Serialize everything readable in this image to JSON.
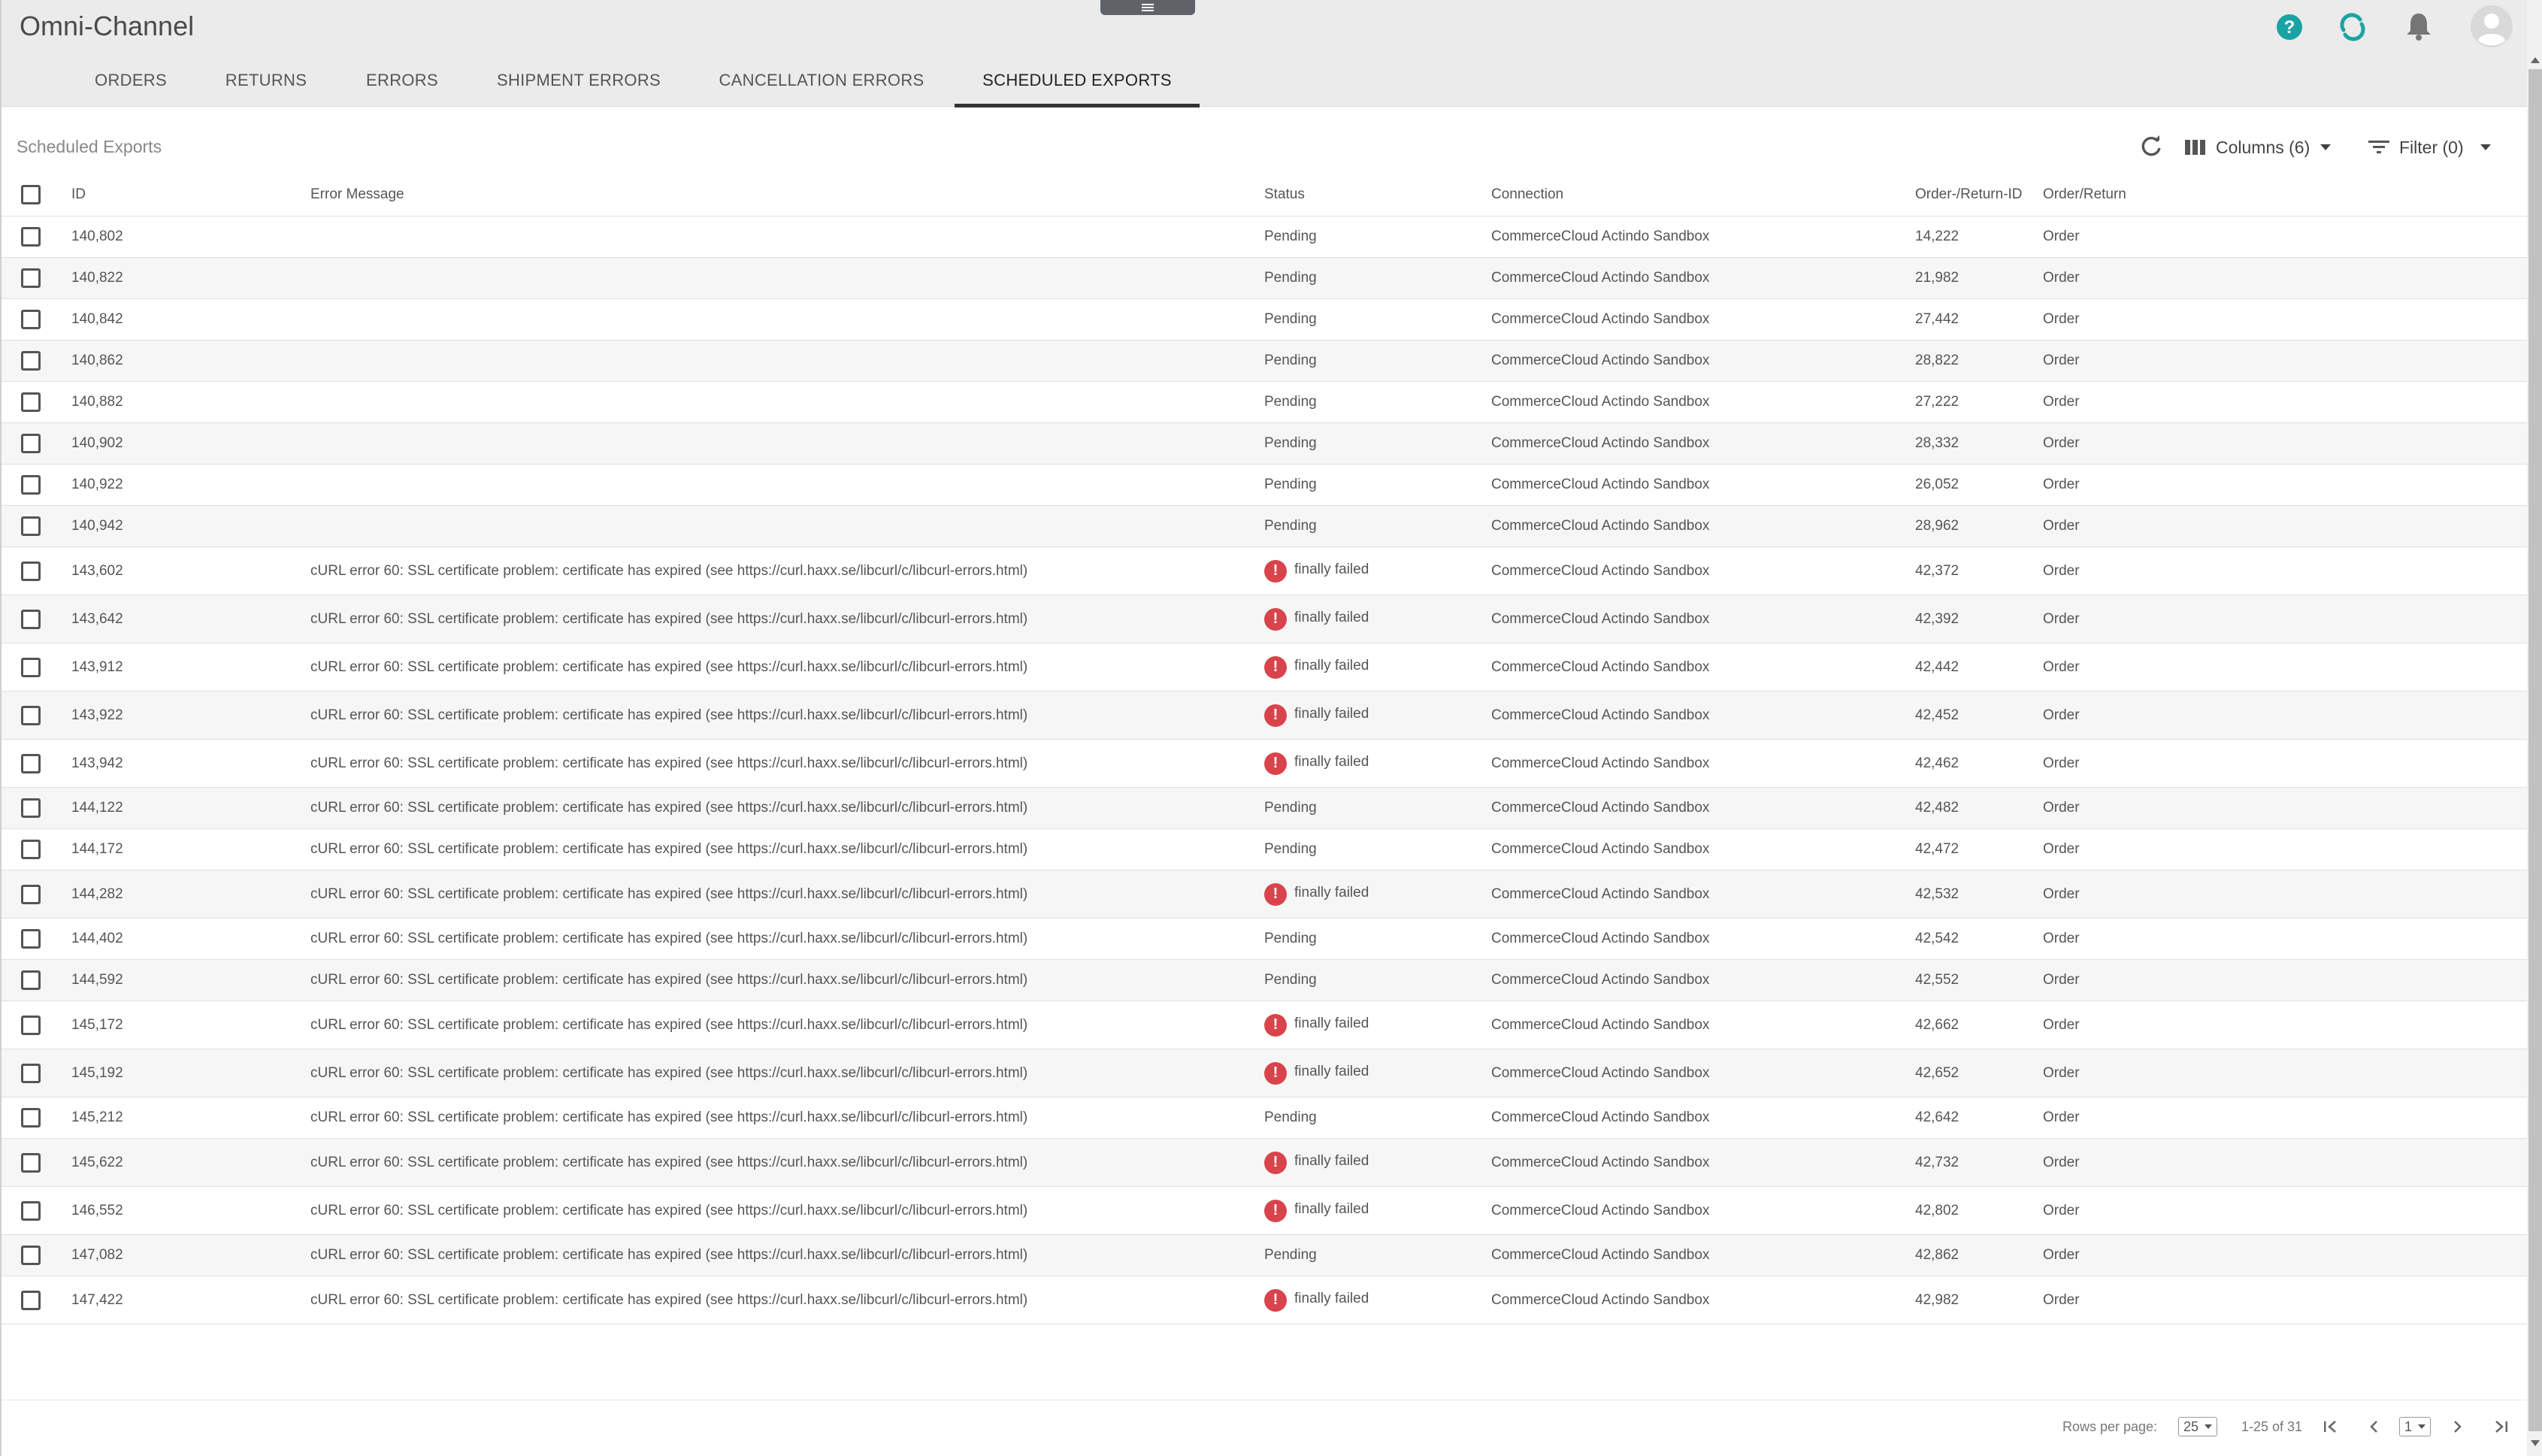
{
  "app": {
    "title": "Omni-Channel"
  },
  "tabs": [
    {
      "label": "ORDERS",
      "active": false
    },
    {
      "label": "RETURNS",
      "active": false
    },
    {
      "label": "ERRORS",
      "active": false
    },
    {
      "label": "SHIPMENT ERRORS",
      "active": false
    },
    {
      "label": "CANCELLATION ERRORS",
      "active": false
    },
    {
      "label": "SCHEDULED EXPORTS",
      "active": true
    }
  ],
  "header_icons": [
    "help-icon",
    "sync-icon",
    "bell-icon",
    "avatar-icon"
  ],
  "colors": {
    "accent": "#1aa3a3",
    "error": "#d9434b",
    "active_tab_underline": "#333333"
  },
  "toolbar": {
    "section_title": "Scheduled Exports",
    "refresh_icon": "refresh-icon",
    "columns_label": "Columns (6)",
    "filter_label": "Filter (0)"
  },
  "table": {
    "headers": {
      "id": "ID",
      "message": "Error Message",
      "status": "Status",
      "connection": "Connection",
      "order_id": "Order-/Return-ID",
      "type": "Order/Return"
    },
    "rows": [
      {
        "id": "140,802",
        "message": "",
        "status": "Pending",
        "failed": false,
        "connection": "CommerceCloud Actindo Sandbox",
        "order_id": "14,222",
        "type": "Order"
      },
      {
        "id": "140,822",
        "message": "",
        "status": "Pending",
        "failed": false,
        "connection": "CommerceCloud Actindo Sandbox",
        "order_id": "21,982",
        "type": "Order"
      },
      {
        "id": "140,842",
        "message": "",
        "status": "Pending",
        "failed": false,
        "connection": "CommerceCloud Actindo Sandbox",
        "order_id": "27,442",
        "type": "Order"
      },
      {
        "id": "140,862",
        "message": "",
        "status": "Pending",
        "failed": false,
        "connection": "CommerceCloud Actindo Sandbox",
        "order_id": "28,822",
        "type": "Order"
      },
      {
        "id": "140,882",
        "message": "",
        "status": "Pending",
        "failed": false,
        "connection": "CommerceCloud Actindo Sandbox",
        "order_id": "27,222",
        "type": "Order"
      },
      {
        "id": "140,902",
        "message": "",
        "status": "Pending",
        "failed": false,
        "connection": "CommerceCloud Actindo Sandbox",
        "order_id": "28,332",
        "type": "Order"
      },
      {
        "id": "140,922",
        "message": "",
        "status": "Pending",
        "failed": false,
        "connection": "CommerceCloud Actindo Sandbox",
        "order_id": "26,052",
        "type": "Order"
      },
      {
        "id": "140,942",
        "message": "",
        "status": "Pending",
        "failed": false,
        "connection": "CommerceCloud Actindo Sandbox",
        "order_id": "28,962",
        "type": "Order"
      },
      {
        "id": "143,602",
        "message": "cURL error 60: SSL certificate problem: certificate has expired (see https://curl.haxx.se/libcurl/c/libcurl-errors.html)",
        "status": "finally failed",
        "failed": true,
        "connection": "CommerceCloud Actindo Sandbox",
        "order_id": "42,372",
        "type": "Order"
      },
      {
        "id": "143,642",
        "message": "cURL error 60: SSL certificate problem: certificate has expired (see https://curl.haxx.se/libcurl/c/libcurl-errors.html)",
        "status": "finally failed",
        "failed": true,
        "connection": "CommerceCloud Actindo Sandbox",
        "order_id": "42,392",
        "type": "Order"
      },
      {
        "id": "143,912",
        "message": "cURL error 60: SSL certificate problem: certificate has expired (see https://curl.haxx.se/libcurl/c/libcurl-errors.html)",
        "status": "finally failed",
        "failed": true,
        "connection": "CommerceCloud Actindo Sandbox",
        "order_id": "42,442",
        "type": "Order"
      },
      {
        "id": "143,922",
        "message": "cURL error 60: SSL certificate problem: certificate has expired (see https://curl.haxx.se/libcurl/c/libcurl-errors.html)",
        "status": "finally failed",
        "failed": true,
        "connection": "CommerceCloud Actindo Sandbox",
        "order_id": "42,452",
        "type": "Order"
      },
      {
        "id": "143,942",
        "message": "cURL error 60: SSL certificate problem: certificate has expired (see https://curl.haxx.se/libcurl/c/libcurl-errors.html)",
        "status": "finally failed",
        "failed": true,
        "connection": "CommerceCloud Actindo Sandbox",
        "order_id": "42,462",
        "type": "Order"
      },
      {
        "id": "144,122",
        "message": "cURL error 60: SSL certificate problem: certificate has expired (see https://curl.haxx.se/libcurl/c/libcurl-errors.html)",
        "status": "Pending",
        "failed": false,
        "connection": "CommerceCloud Actindo Sandbox",
        "order_id": "42,482",
        "type": "Order"
      },
      {
        "id": "144,172",
        "message": "cURL error 60: SSL certificate problem: certificate has expired (see https://curl.haxx.se/libcurl/c/libcurl-errors.html)",
        "status": "Pending",
        "failed": false,
        "connection": "CommerceCloud Actindo Sandbox",
        "order_id": "42,472",
        "type": "Order"
      },
      {
        "id": "144,282",
        "message": "cURL error 60: SSL certificate problem: certificate has expired (see https://curl.haxx.se/libcurl/c/libcurl-errors.html)",
        "status": "finally failed",
        "failed": true,
        "connection": "CommerceCloud Actindo Sandbox",
        "order_id": "42,532",
        "type": "Order"
      },
      {
        "id": "144,402",
        "message": "cURL error 60: SSL certificate problem: certificate has expired (see https://curl.haxx.se/libcurl/c/libcurl-errors.html)",
        "status": "Pending",
        "failed": false,
        "connection": "CommerceCloud Actindo Sandbox",
        "order_id": "42,542",
        "type": "Order"
      },
      {
        "id": "144,592",
        "message": "cURL error 60: SSL certificate problem: certificate has expired (see https://curl.haxx.se/libcurl/c/libcurl-errors.html)",
        "status": "Pending",
        "failed": false,
        "connection": "CommerceCloud Actindo Sandbox",
        "order_id": "42,552",
        "type": "Order"
      },
      {
        "id": "145,172",
        "message": "cURL error 60: SSL certificate problem: certificate has expired (see https://curl.haxx.se/libcurl/c/libcurl-errors.html)",
        "status": "finally failed",
        "failed": true,
        "connection": "CommerceCloud Actindo Sandbox",
        "order_id": "42,662",
        "type": "Order"
      },
      {
        "id": "145,192",
        "message": "cURL error 60: SSL certificate problem: certificate has expired (see https://curl.haxx.se/libcurl/c/libcurl-errors.html)",
        "status": "finally failed",
        "failed": true,
        "connection": "CommerceCloud Actindo Sandbox",
        "order_id": "42,652",
        "type": "Order"
      },
      {
        "id": "145,212",
        "message": "cURL error 60: SSL certificate problem: certificate has expired (see https://curl.haxx.se/libcurl/c/libcurl-errors.html)",
        "status": "Pending",
        "failed": false,
        "connection": "CommerceCloud Actindo Sandbox",
        "order_id": "42,642",
        "type": "Order"
      },
      {
        "id": "145,622",
        "message": "cURL error 60: SSL certificate problem: certificate has expired (see https://curl.haxx.se/libcurl/c/libcurl-errors.html)",
        "status": "finally failed",
        "failed": true,
        "connection": "CommerceCloud Actindo Sandbox",
        "order_id": "42,732",
        "type": "Order"
      },
      {
        "id": "146,552",
        "message": "cURL error 60: SSL certificate problem: certificate has expired (see https://curl.haxx.se/libcurl/c/libcurl-errors.html)",
        "status": "finally failed",
        "failed": true,
        "connection": "CommerceCloud Actindo Sandbox",
        "order_id": "42,802",
        "type": "Order"
      },
      {
        "id": "147,082",
        "message": "cURL error 60: SSL certificate problem: certificate has expired (see https://curl.haxx.se/libcurl/c/libcurl-errors.html)",
        "status": "Pending",
        "failed": false,
        "connection": "CommerceCloud Actindo Sandbox",
        "order_id": "42,862",
        "type": "Order"
      },
      {
        "id": "147,422",
        "message": "cURL error 60: SSL certificate problem: certificate has expired (see https://curl.haxx.se/libcurl/c/libcurl-errors.html)",
        "status": "finally failed",
        "failed": true,
        "connection": "CommerceCloud Actindo Sandbox",
        "order_id": "42,982",
        "type": "Order"
      }
    ]
  },
  "pagination": {
    "rows_per_page_label": "Rows per page:",
    "rows_per_page_value": "25",
    "range_label": "1-25 of 31",
    "page_value": "1"
  }
}
